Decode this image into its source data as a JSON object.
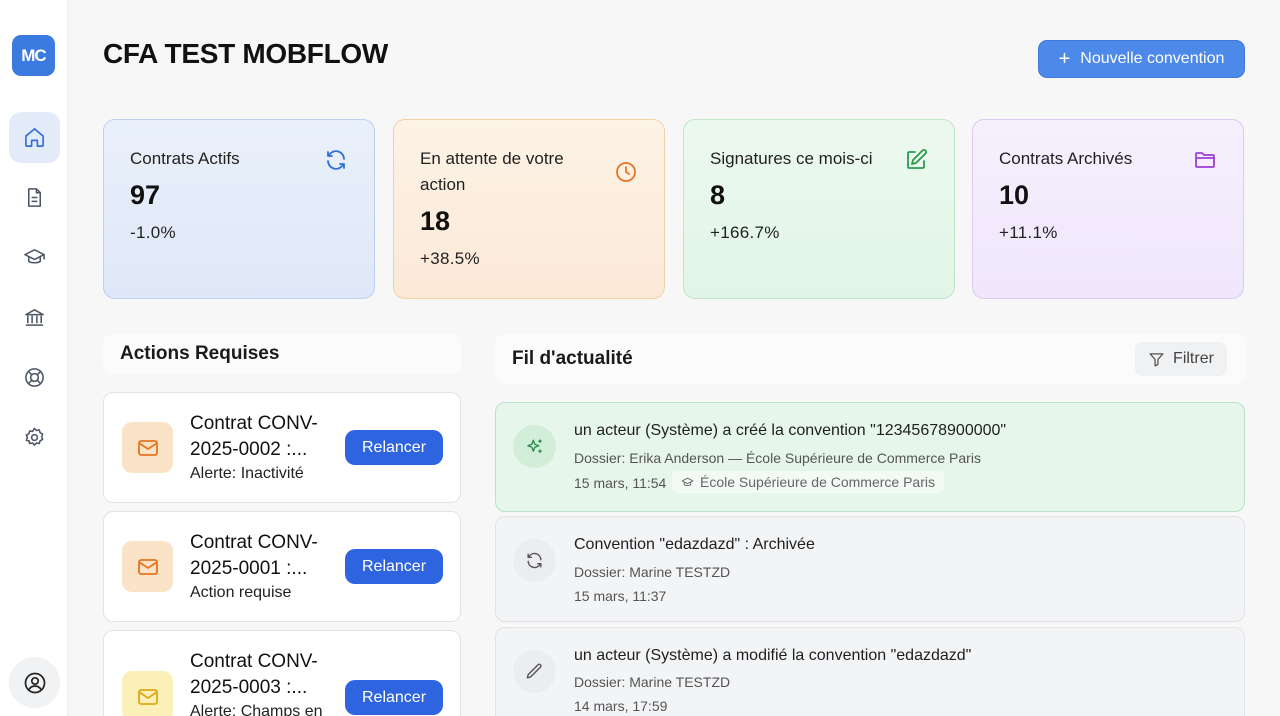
{
  "app": {
    "logo_text": "MC",
    "accent": "#4c89e8"
  },
  "header": {
    "title": "CFA TEST MOBFLOW",
    "new_button": "Nouvelle convention"
  },
  "sidebar": {
    "items": [
      {
        "icon": "home-icon",
        "active": true
      },
      {
        "icon": "document-icon",
        "active": false
      },
      {
        "icon": "graduation-cap-icon",
        "active": false
      },
      {
        "icon": "bank-icon",
        "active": false
      },
      {
        "icon": "lifebuoy-icon",
        "active": false
      },
      {
        "icon": "gear-icon",
        "active": false
      }
    ],
    "profile_icon": "user-circle-icon"
  },
  "stats": [
    {
      "label": "Contrats Actifs",
      "value": "97",
      "delta": "-1.0%",
      "icon": "refresh-icon",
      "color": "#2f6fdc"
    },
    {
      "label": "En attente de votre action",
      "value": "18",
      "delta": "+38.5%",
      "icon": "clock-icon",
      "color": "#e8741f"
    },
    {
      "label": "Signatures ce mois-ci",
      "value": "8",
      "delta": "+166.7%",
      "icon": "edit-icon",
      "color": "#2e9a4e"
    },
    {
      "label": "Contrats Archivés",
      "value": "10",
      "delta": "+11.1%",
      "icon": "folder-icon",
      "color": "#9b3fd9"
    }
  ],
  "actions": {
    "title": "Actions Requises",
    "button_label": "Relancer",
    "items": [
      {
        "title": "Contrat CONV-2025-0002 :...",
        "line1": "Contrat CONV-",
        "line2": "2025-0002 :...",
        "subtitle": "Alerte: Inactivité",
        "tone": "orange"
      },
      {
        "title": "Contrat CONV-2025-0001 :...",
        "line1": "Contrat CONV-",
        "line2": "2025-0001 :...",
        "subtitle": "Action requise",
        "tone": "orange"
      },
      {
        "title": "Contrat CONV-2025-0003 :...",
        "line1": "Contrat CONV-",
        "line2": "2025-0003 :...",
        "subtitle": "Alerte: Champs en",
        "tone": "yellow"
      }
    ]
  },
  "feed": {
    "title": "Fil d'actualité",
    "filter_label": "Filtrer",
    "items": [
      {
        "icon": "sparkles-icon",
        "text": "un acteur (Système) a créé la convention \"12345678900000\"",
        "dossier": "Dossier: Erika Anderson — École Supérieure de Commerce Paris",
        "time": "15 mars, 11:54",
        "tag": "École Supérieure de Commerce Paris",
        "highlight": true
      },
      {
        "icon": "refresh-icon",
        "text": "Convention \"edazdazd\" : Archivée",
        "dossier": "Dossier: Marine TESTZD",
        "time": "15 mars, 11:37",
        "highlight": false
      },
      {
        "icon": "pencil-icon",
        "text": "un acteur (Système) a modifié la convention \"edazdazd\"",
        "dossier": "Dossier: Marine TESTZD",
        "time": "14 mars, 17:59",
        "highlight": false
      }
    ]
  }
}
